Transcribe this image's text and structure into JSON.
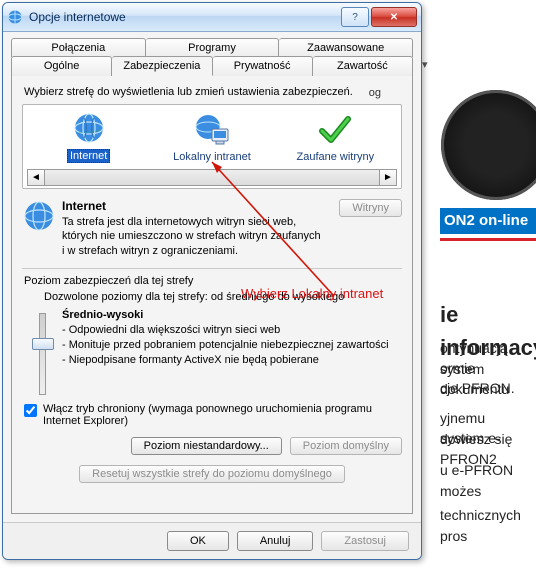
{
  "window": {
    "title": "Opcje internetowe"
  },
  "tabs": {
    "top": [
      "Połączenia",
      "Programy",
      "Zaawansowane"
    ],
    "bottom": [
      "Ogólne",
      "Zabezpieczenia",
      "Prywatność",
      "Zawartość"
    ],
    "active": "Zabezpieczenia"
  },
  "panel": {
    "intro": "Wybierz strefę do wyświetlenia lub zmień ustawienia zabezpieczeń.",
    "overflow_hint": "og",
    "zones": [
      {
        "label": "Internet",
        "icon": "globe-icon",
        "selected": true
      },
      {
        "label": "Lokalny intranet",
        "icon": "globe-monitor-icon",
        "selected": false
      },
      {
        "label": "Zaufane witryny",
        "icon": "checkmark-icon",
        "selected": false
      }
    ],
    "current": {
      "name": "Internet",
      "desc": "Ta strefa jest dla internetowych witryn sieci web, których nie umieszczono w strefach witryn zaufanych i w strefach witryn z ograniczeniami.",
      "sites_btn": "Witryny"
    },
    "security": {
      "heading": "Poziom zabezpieczeń dla tej strefy",
      "allowed": "Dozwolone poziomy dla tej strefy: od średniego do wysokiego",
      "level": "Średnio-wysoki",
      "bullets": [
        "- Odpowiedni dla większości witryn sieci web",
        "- Monituje przed pobraniem potencjalnie niebezpiecznej zawartości",
        "- Niepodpisane formanty ActiveX nie będą pobierane"
      ],
      "protected_mode": {
        "checked": true,
        "label": "Włącz tryb chroniony (wymaga ponownego uruchomienia programu Internet Explorer)"
      },
      "btn_custom": "Poziom niestandardowy...",
      "btn_default": "Poziom domyślny",
      "btn_reset": "Resetuj wszystkie strefy do poziomu domyślnego"
    }
  },
  "footer": {
    "ok": "OK",
    "cancel": "Anuluj",
    "apply": "Zastosuj"
  },
  "annotation": {
    "text": "Wybierz Lokalny intranet",
    "color": "#d11507"
  },
  "background": {
    "blue_bar": "ON2 on-line",
    "title": "ie informacy",
    "p1": "ontynuacją system",
    "p2": "ormie dokumentu",
    "p3": "cje PFRON.",
    "p4": "yjnemu dowiesz się",
    "p5": "system e-PFRON2",
    "p6": "u e-PFRON możes",
    "p7": "technicznych pros"
  }
}
